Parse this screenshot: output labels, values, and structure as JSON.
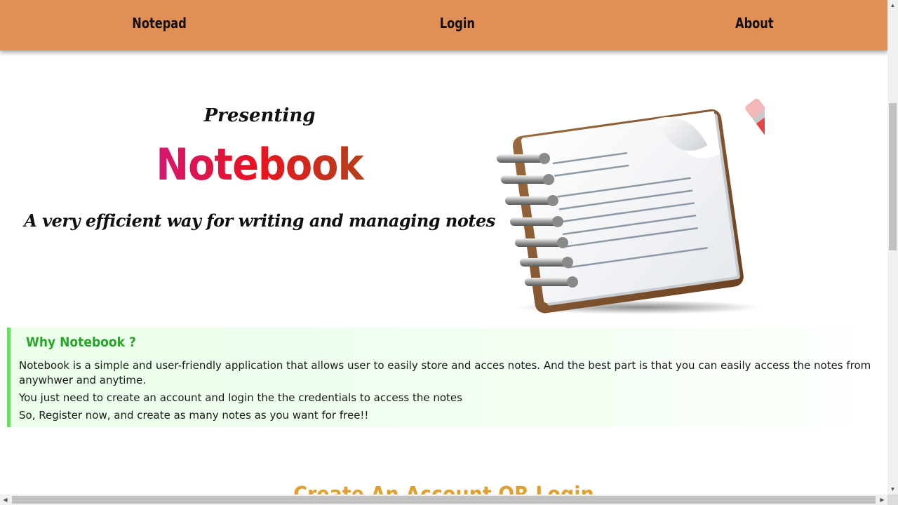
{
  "nav": {
    "items": [
      {
        "label": "Notepad"
      },
      {
        "label": "Login"
      },
      {
        "label": "About"
      }
    ],
    "background_color": "#e08f57"
  },
  "hero": {
    "kicker": "Presenting",
    "title": "Notebook",
    "tagline": "A very efficient way for writing and managing notes",
    "image_icon": "notepad-with-pencil-icon"
  },
  "why": {
    "heading": "Why Notebook ?",
    "paragraphs": [
      "Notebook is a simple and user-friendly application that allows user to easily store and acces notes. And the best part is that you can easily access the notes from anywhwer and anytime.",
      "You just need to create an account and login the the credentials to access the notes",
      "So, Register now, and create as many notes as you want for free!!"
    ],
    "accent_color": "#5fe05f",
    "heading_color": "#2aa52a"
  },
  "cta": {
    "heading": "Create An Account OR Login"
  }
}
